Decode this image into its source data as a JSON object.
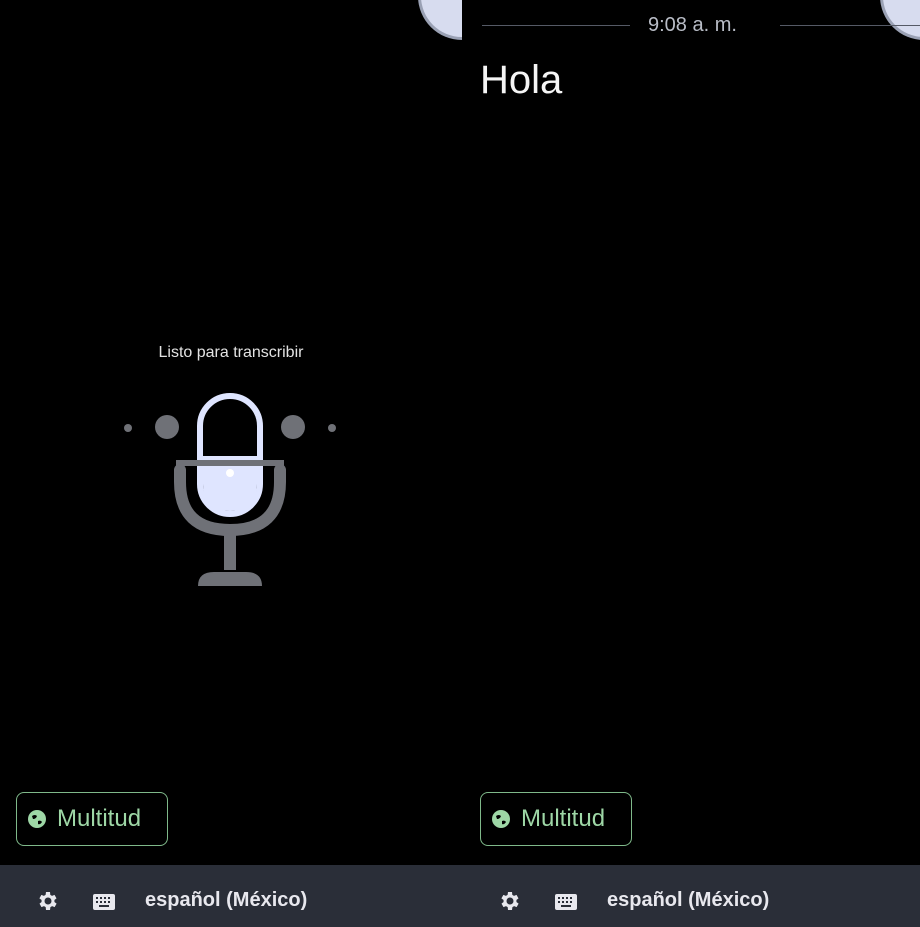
{
  "left_screen": {
    "status_text": "Listo para transcribir",
    "language_chip": {
      "label": "Multitud",
      "icon": "globe-icon"
    },
    "bottom_bar": {
      "settings_icon": "gear-icon",
      "keyboard_icon": "keyboard-icon",
      "language": "español (México)"
    }
  },
  "right_screen": {
    "timestamp": "9:08 a. m.",
    "transcript_text": "Hola",
    "language_chip": {
      "label": "Multitud",
      "icon": "globe-icon"
    },
    "bottom_bar": {
      "settings_icon": "gear-icon",
      "keyboard_icon": "keyboard-icon",
      "language": "español (México)"
    }
  },
  "colors": {
    "background": "#000000",
    "bottom_bar": "#2a2e38",
    "chip_accent": "#9ed7a6",
    "mic_fill": "#dfe5ff",
    "mic_stand": "#6f7177"
  },
  "mic_icon": "microphone-icon"
}
